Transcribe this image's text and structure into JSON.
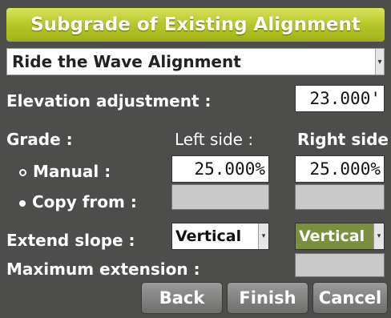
{
  "title": "Subgrade of Existing Alignment",
  "alignment": {
    "selected": "Ride the Wave Alignment"
  },
  "elevation": {
    "label": "Elevation adjustment :",
    "value": "23.000'"
  },
  "grade": {
    "label": "Grade :",
    "left_header": "Left side :",
    "right_header": "Right side",
    "manual_label": "Manual :",
    "copy_label": "Copy from :",
    "left_manual": "25.000%",
    "right_manual": "25.000%"
  },
  "extend": {
    "label": "Extend slope :",
    "left_value": "Vertical",
    "right_value": "Vertical"
  },
  "max_ext": {
    "label": "Maximum extension :"
  },
  "buttons": {
    "back": "Back",
    "finish": "Finish",
    "cancel": "Cancel"
  },
  "icons": {
    "dropdown": "chevron-down-icon"
  },
  "colors": {
    "title_bar": "#b8c92a",
    "selected_select": "#7c8f3e",
    "background": "#4d4d4b"
  }
}
